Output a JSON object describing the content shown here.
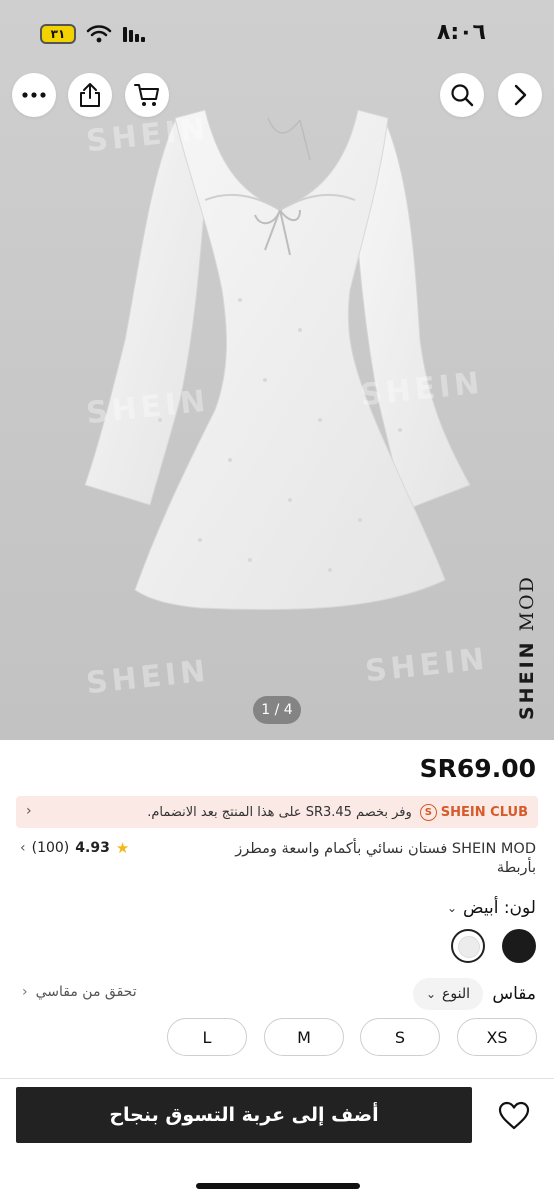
{
  "status_bar": {
    "time": "٨:٠٦",
    "battery": "٣١"
  },
  "hero": {
    "watermark": "SHEIN",
    "brand_vertical": {
      "main": "SHEIN",
      "sub": "MOD"
    },
    "pager": "1 / 4"
  },
  "top_buttons": [
    "more-icon",
    "share-icon",
    "cart-icon",
    "search-icon",
    "forward-icon"
  ],
  "product": {
    "price": "SR69.00",
    "club": {
      "badge": "SHEIN CLUB",
      "text": "وفر بخصم SR3.45 على هذا المنتج بعد الانضمام."
    },
    "title": "SHEIN MOD فستان نسائي بأكمام واسعة ومطرز بأربطة",
    "rating": {
      "score": "4.93",
      "count": "(100)"
    },
    "color": {
      "label": "لون: أبيض",
      "swatches": [
        "#1b1b1b",
        "#ececec"
      ],
      "selected": 1
    },
    "size": {
      "label": "مقاس",
      "type_select": "النوع",
      "fit_check": "تحقق من مقاسي",
      "options": [
        "XS",
        "S",
        "M",
        "L"
      ]
    }
  },
  "footer": {
    "add_to_cart": "أضف إلى عربة التسوق بنجاح"
  },
  "colors": {
    "accent": "#d65a2a",
    "club_bg": "#fbe9e6",
    "button": "#222222",
    "star": "#f3b81b"
  }
}
